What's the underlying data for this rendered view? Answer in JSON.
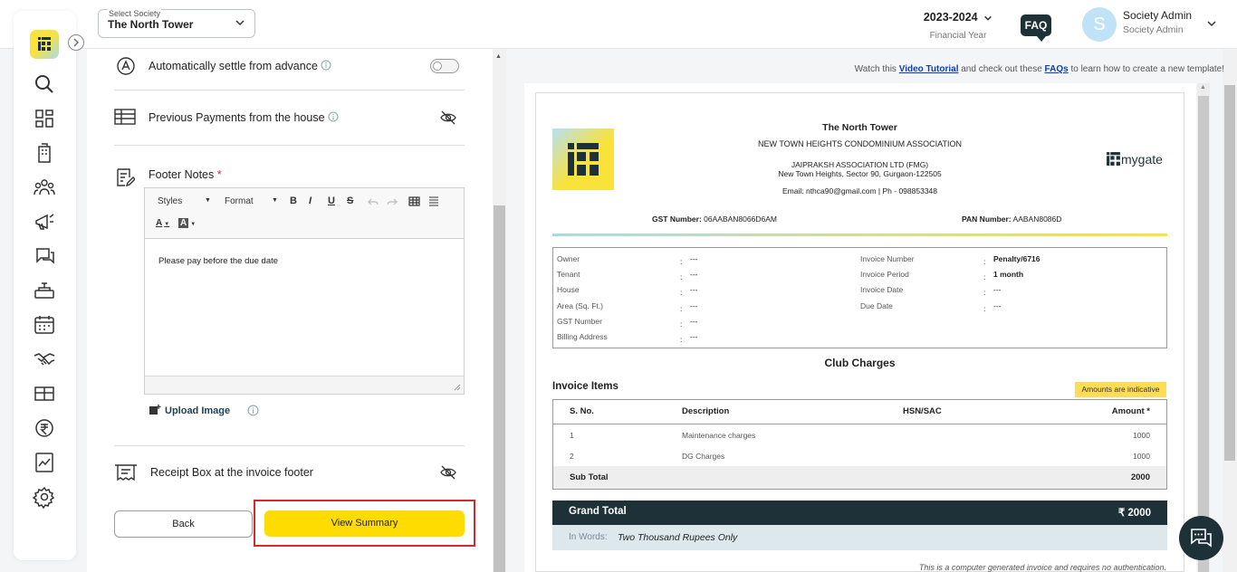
{
  "header": {
    "society_select_label": "Select Society",
    "society_select_value": "The North Tower",
    "financial_year": "2023-2024",
    "financial_year_label": "Financial Year",
    "faq_label": "FAQ",
    "avatar_letter": "S",
    "user_name": "Society Admin",
    "user_role": "Society Admin"
  },
  "sidebar": {
    "items": [
      "search-icon",
      "dashboard-icon",
      "building-icon",
      "residents-icon",
      "announcement-icon",
      "helpdesk-icon",
      "amenities-icon",
      "calendar-icon",
      "partners-icon",
      "parcel-icon",
      "payments-icon",
      "reports-icon",
      "settings-icon"
    ]
  },
  "settings": {
    "auto_settle_label": "Automatically settle from advance",
    "auto_settle_enabled": false,
    "previous_payments_label": "Previous Payments from the house",
    "footer_notes_label": "Footer Notes",
    "required_mark": "*",
    "editor": {
      "styles_label": "Styles",
      "format_label": "Format",
      "bold": "B",
      "italic": "I",
      "underline": "U",
      "strike": "S",
      "text_color": "A",
      "bg_color": "A",
      "content": "Please pay before the due date"
    },
    "upload_image_label": "Upload Image",
    "receipt_box_label": "Receipt Box at the invoice footer",
    "back_label": "Back",
    "view_summary_label": "View Summary"
  },
  "tutorial": {
    "prefix": "Watch this",
    "video_link": "Video Tutorial",
    "middle": "and check out these",
    "faq_link": "FAQs",
    "suffix": "to learn how to create a new template!"
  },
  "invoice": {
    "society_name": "The North Tower",
    "association": "NEW TOWN HEIGHTS CONDOMINIUM ASSOCIATION",
    "company": "JAIPRAKSH ASSOCIATION LTD (FMG)",
    "address": "New Town Heights, Sector 90, Gurgaon-122505",
    "contact": "Email: nthca90@gmail.com | Ph - 098853348",
    "brand": "mygate",
    "gst_label": "GST Number:",
    "gst_value": "06AABAN8066D6AM",
    "pan_label": "PAN Number:",
    "pan_value": "AABAN8086D",
    "left_details": [
      {
        "label": "Owner",
        "value": "---"
      },
      {
        "label": "Tenant",
        "value": "---"
      },
      {
        "label": "House",
        "value": "---"
      },
      {
        "label": "Area (Sq. Ft.)",
        "value": "---"
      },
      {
        "label": "GST Number",
        "value": "---"
      },
      {
        "label": "Billing Address",
        "value": "---"
      }
    ],
    "right_details": [
      {
        "label": "Invoice Number",
        "value": "Penalty/6716"
      },
      {
        "label": "Invoice Period",
        "value": "1 month"
      },
      {
        "label": "Invoice Date",
        "value": "---"
      },
      {
        "label": "Due Date",
        "value": "---"
      }
    ],
    "section_title": "Club Charges",
    "items_title": "Invoice Items",
    "indicative_note": "Amounts are indicative",
    "columns": [
      "S. No.",
      "Description",
      "HSN/SAC",
      "Amount *"
    ],
    "rows": [
      {
        "sno": "1",
        "description": "Maintenance charges",
        "hsn": "",
        "amount": "1000"
      },
      {
        "sno": "2",
        "description": "DG Charges",
        "hsn": "",
        "amount": "1000"
      }
    ],
    "subtotal_label": "Sub Total",
    "subtotal_value": "2000",
    "grand_total_label": "Grand Total",
    "grand_total_value": "₹ 2000",
    "in_words_label": "In Words:",
    "in_words_value": "Two Thousand Rupees Only",
    "footer_note": "This is a computer generated invoice and requires no authentication."
  }
}
